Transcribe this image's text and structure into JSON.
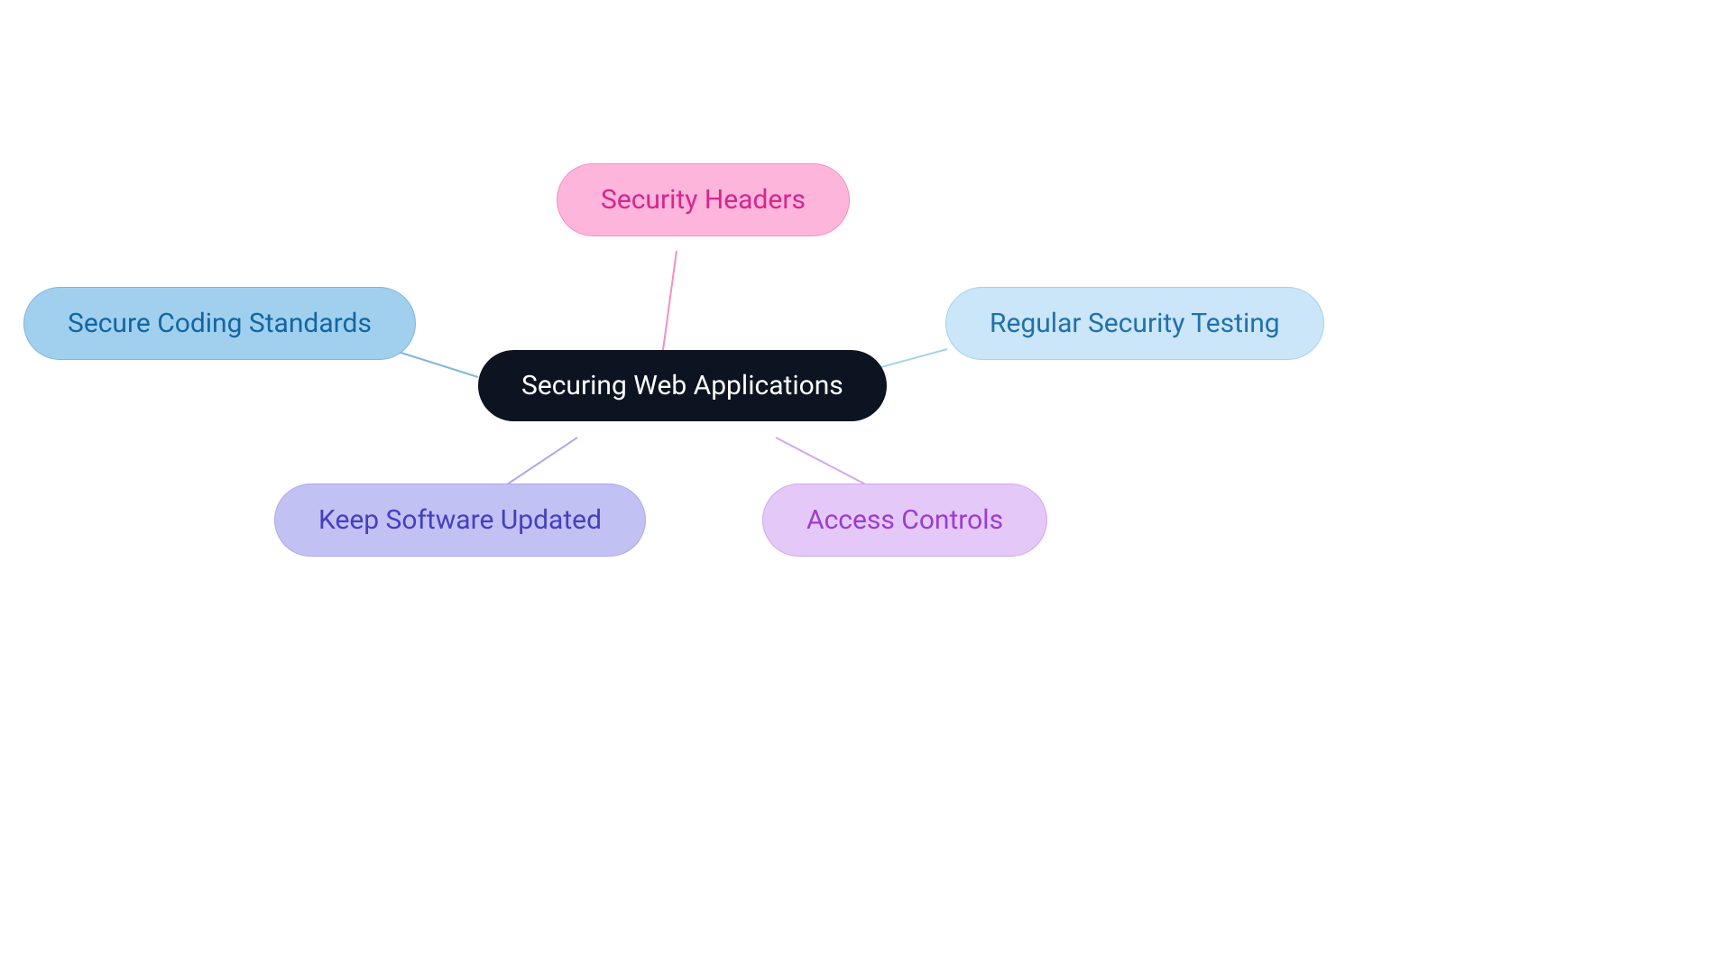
{
  "diagram": {
    "center": {
      "label": "Securing Web Applications"
    },
    "nodes": {
      "top": {
        "label": "Security Headers"
      },
      "right": {
        "label": "Regular Security Testing"
      },
      "bottomRight": {
        "label": "Access Controls"
      },
      "bottomLeft": {
        "label": "Keep Software Updated"
      },
      "left": {
        "label": "Secure Coding Standards"
      }
    }
  }
}
